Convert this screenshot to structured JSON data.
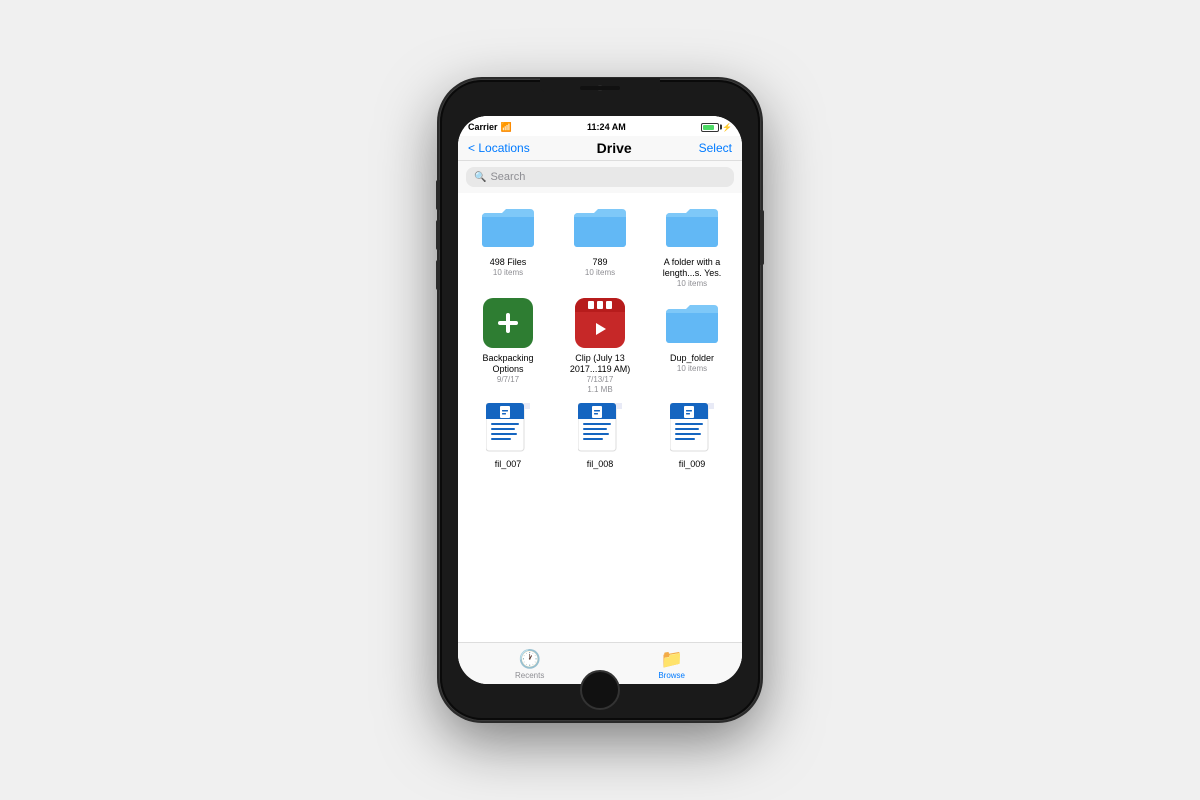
{
  "statusBar": {
    "carrier": "Carrier",
    "time": "11:24 AM",
    "signal": "●●●",
    "wifi": "wifi",
    "battery": "green"
  },
  "navBar": {
    "backLabel": "< Locations",
    "title": "Drive",
    "selectLabel": "Select"
  },
  "search": {
    "placeholder": "Search"
  },
  "files": [
    {
      "type": "folder",
      "name": "498 Files",
      "meta1": "10 items",
      "meta2": ""
    },
    {
      "type": "folder",
      "name": "789",
      "meta1": "10 items",
      "meta2": ""
    },
    {
      "type": "folder",
      "name": "A folder with a length...s. Yes.",
      "meta1": "10 items",
      "meta2": ""
    },
    {
      "type": "app",
      "name": "Backpacking Options",
      "meta1": "9/7/17",
      "meta2": "",
      "bgColor": "#2e7d32",
      "symbol": "+"
    },
    {
      "type": "clip",
      "name": "Clip (July 13 2017...119 AM)",
      "meta1": "7/13/17",
      "meta2": "1.1 MB",
      "bgColor": "#c62828",
      "symbol": "▶"
    },
    {
      "type": "folder",
      "name": "Dup_folder",
      "meta1": "10 items",
      "meta2": ""
    },
    {
      "type": "doc",
      "name": "fil_007",
      "meta1": "",
      "meta2": ""
    },
    {
      "type": "doc",
      "name": "fil_008",
      "meta1": "",
      "meta2": ""
    },
    {
      "type": "doc",
      "name": "fil_009",
      "meta1": "",
      "meta2": ""
    }
  ],
  "tabBar": {
    "items": [
      {
        "label": "Recents",
        "icon": "🕐",
        "active": false
      },
      {
        "label": "Browse",
        "icon": "📁",
        "active": true
      }
    ]
  }
}
